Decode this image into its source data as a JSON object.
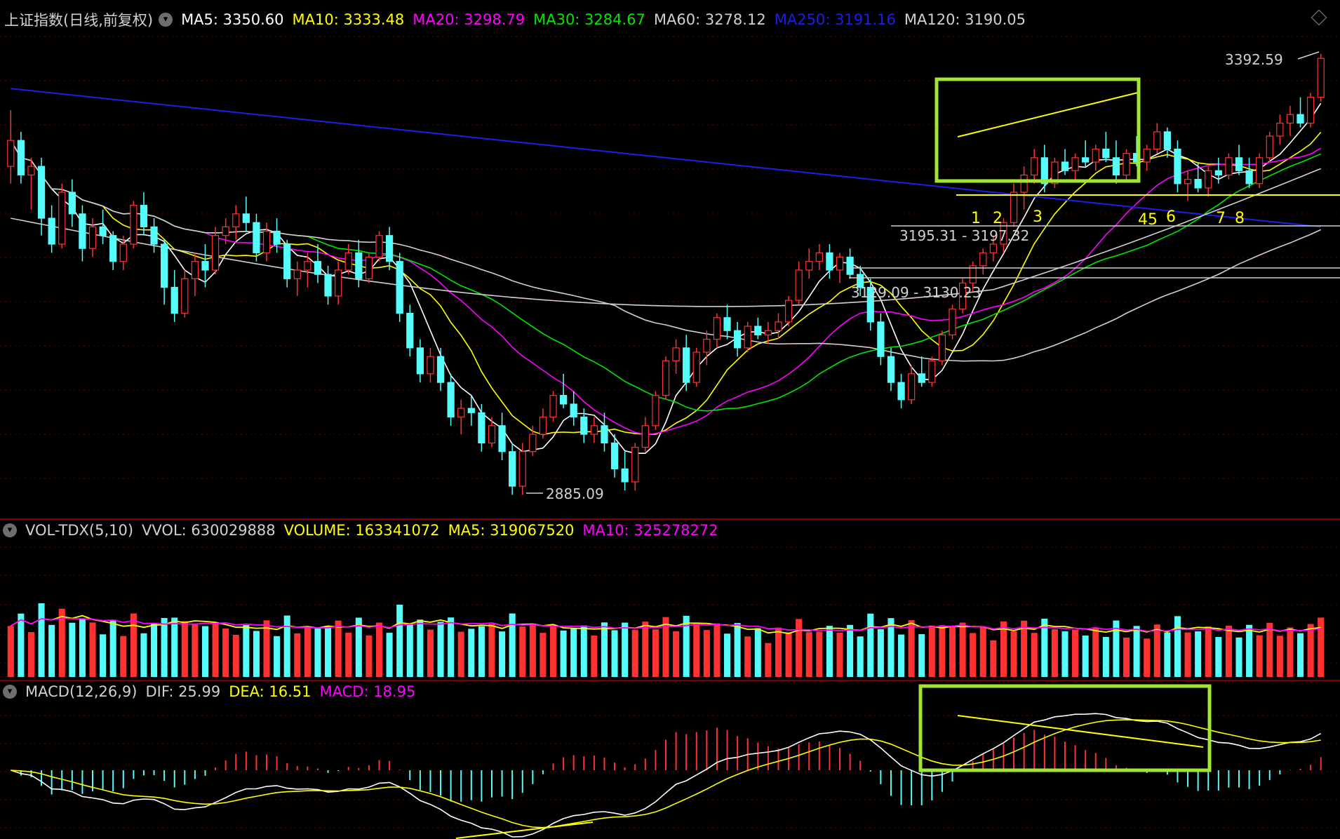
{
  "main_header": {
    "title": "上证指数(日线,前复权)",
    "ma5": "MA5: 3350.60",
    "ma10": "MA10: 3333.48",
    "ma20": "MA20: 3298.79",
    "ma30": "MA30: 3284.67",
    "ma60": "MA60: 3278.12",
    "ma250": "MA250: 3191.16",
    "ma120": "MA120: 3190.05"
  },
  "vol_header": {
    "title": "VOL-TDX(5,10)",
    "vvol": "VVOL: 630029888",
    "volume": "VOLUME: 163341072",
    "ma5": "MA5: 319067520",
    "ma10": "MA10: 325278272"
  },
  "macd_header": {
    "title": "MACD(12,26,9)",
    "dif": "DIF: 25.99",
    "dea": "DEA: 16.51",
    "macd": "MACD: 18.95"
  },
  "annotations": {
    "high": "3392.59",
    "low": "2885.09",
    "range1": "3195.31 - 3197.32",
    "range2": "3129.09 - 3130.23",
    "num1": "1",
    "num2": "2",
    "num3": "3",
    "num45": "45",
    "num6": "6",
    "num7": "7",
    "num8": "8"
  },
  "colors": {
    "up": "#ff3232",
    "down": "#54fcfc",
    "ma5": "#ffffff",
    "ma10": "#ffff00",
    "ma20": "#ff00ff",
    "ma30": "#00e600",
    "ma60": "#d0d0d0",
    "ma250": "#1e1ee6",
    "ma120": "#d0d0d0",
    "highlight": "#a0e632",
    "grid": "#6e0000"
  },
  "chart_data": {
    "type": "candlestick",
    "symbol": "上证指数",
    "period": "daily",
    "y_range": [
      2860,
      3420
    ],
    "candles_ohlc": [
      [
        3260,
        3325,
        3240,
        3290
      ],
      [
        3290,
        3300,
        3240,
        3250
      ],
      [
        3250,
        3270,
        3210,
        3260
      ],
      [
        3260,
        3270,
        3180,
        3200
      ],
      [
        3200,
        3215,
        3160,
        3170
      ],
      [
        3170,
        3240,
        3165,
        3230
      ],
      [
        3230,
        3245,
        3190,
        3205
      ],
      [
        3205,
        3215,
        3150,
        3165
      ],
      [
        3165,
        3200,
        3155,
        3190
      ],
      [
        3190,
        3210,
        3170,
        3180
      ],
      [
        3180,
        3185,
        3140,
        3150
      ],
      [
        3150,
        3180,
        3140,
        3170
      ],
      [
        3170,
        3220,
        3165,
        3215
      ],
      [
        3215,
        3230,
        3180,
        3190
      ],
      [
        3190,
        3200,
        3160,
        3170
      ],
      [
        3170,
        3175,
        3100,
        3120
      ],
      [
        3120,
        3140,
        3080,
        3090
      ],
      [
        3090,
        3140,
        3085,
        3130
      ],
      [
        3130,
        3160,
        3110,
        3150
      ],
      [
        3150,
        3170,
        3120,
        3140
      ],
      [
        3140,
        3190,
        3135,
        3180
      ],
      [
        3180,
        3200,
        3170,
        3190
      ],
      [
        3190,
        3215,
        3175,
        3205
      ],
      [
        3205,
        3225,
        3185,
        3195
      ],
      [
        3195,
        3205,
        3150,
        3160
      ],
      [
        3160,
        3195,
        3150,
        3185
      ],
      [
        3185,
        3200,
        3160,
        3170
      ],
      [
        3170,
        3175,
        3120,
        3130
      ],
      [
        3130,
        3150,
        3110,
        3140
      ],
      [
        3140,
        3160,
        3120,
        3150
      ],
      [
        3150,
        3170,
        3125,
        3135
      ],
      [
        3135,
        3145,
        3100,
        3110
      ],
      [
        3110,
        3150,
        3100,
        3140
      ],
      [
        3140,
        3170,
        3135,
        3160
      ],
      [
        3160,
        3175,
        3120,
        3130
      ],
      [
        3130,
        3160,
        3125,
        3155
      ],
      [
        3155,
        3185,
        3150,
        3180
      ],
      [
        3180,
        3190,
        3140,
        3150
      ],
      [
        3150,
        3160,
        3080,
        3090
      ],
      [
        3090,
        3100,
        3040,
        3050
      ],
      [
        3050,
        3060,
        3010,
        3020
      ],
      [
        3020,
        3050,
        3010,
        3040
      ],
      [
        3040,
        3050,
        3000,
        3010
      ],
      [
        3010,
        3020,
        2960,
        2970
      ],
      [
        2970,
        2990,
        2950,
        2980
      ],
      [
        2980,
        2995,
        2960,
        2975
      ],
      [
        2975,
        2985,
        2930,
        2940
      ],
      [
        2940,
        2970,
        2935,
        2960
      ],
      [
        2960,
        2975,
        2920,
        2930
      ],
      [
        2930,
        2940,
        2880,
        2890
      ],
      [
        2890,
        2940,
        2880,
        2930
      ],
      [
        2930,
        2960,
        2925,
        2950
      ],
      [
        2950,
        2980,
        2945,
        2970
      ],
      [
        2970,
        3000,
        2965,
        2995
      ],
      [
        2995,
        3020,
        2980,
        2985
      ],
      [
        2985,
        3000,
        2960,
        2970
      ],
      [
        2970,
        2980,
        2940,
        2950
      ],
      [
        2950,
        2970,
        2940,
        2960
      ],
      [
        2960,
        2975,
        2930,
        2940
      ],
      [
        2940,
        2950,
        2900,
        2910
      ],
      [
        2910,
        2930,
        2885,
        2895
      ],
      [
        2895,
        2940,
        2885,
        2935
      ],
      [
        2935,
        2970,
        2930,
        2960
      ],
      [
        2960,
        3000,
        2955,
        2995
      ],
      [
        2995,
        3040,
        2990,
        3035
      ],
      [
        3035,
        3060,
        3020,
        3050
      ],
      [
        3050,
        3065,
        3000,
        3010
      ],
      [
        3010,
        3050,
        3005,
        3045
      ],
      [
        3045,
        3070,
        3030,
        3060
      ],
      [
        3060,
        3090,
        3050,
        3085
      ],
      [
        3085,
        3100,
        3060,
        3070
      ],
      [
        3070,
        3080,
        3040,
        3050
      ],
      [
        3050,
        3080,
        3045,
        3075
      ],
      [
        3075,
        3085,
        3060,
        3065
      ],
      [
        3065,
        3080,
        3055,
        3070
      ],
      [
        3070,
        3090,
        3060,
        3080
      ],
      [
        3080,
        3110,
        3075,
        3105
      ],
      [
        3105,
        3150,
        3100,
        3140
      ],
      [
        3140,
        3165,
        3130,
        3150
      ],
      [
        3150,
        3170,
        3140,
        3160
      ],
      [
        3160,
        3170,
        3130,
        3140
      ],
      [
        3140,
        3160,
        3125,
        3155
      ],
      [
        3155,
        3165,
        3130,
        3135
      ],
      [
        3135,
        3145,
        3110,
        3120
      ],
      [
        3120,
        3130,
        3070,
        3080
      ],
      [
        3080,
        3090,
        3030,
        3040
      ],
      [
        3040,
        3050,
        3000,
        3010
      ],
      [
        3010,
        3020,
        2980,
        2990
      ],
      [
        2990,
        3030,
        2985,
        3020
      ],
      [
        3020,
        3040,
        3005,
        3010
      ],
      [
        3010,
        3040,
        3005,
        3035
      ],
      [
        3035,
        3070,
        3030,
        3065
      ],
      [
        3065,
        3100,
        3060,
        3095
      ],
      [
        3095,
        3130,
        3090,
        3125
      ],
      [
        3125,
        3150,
        3115,
        3145
      ],
      [
        3145,
        3165,
        3135,
        3160
      ],
      [
        3160,
        3180,
        3150,
        3170
      ],
      [
        3170,
        3200,
        3160,
        3195
      ],
      [
        3195,
        3240,
        3190,
        3230
      ],
      [
        3230,
        3260,
        3210,
        3250
      ],
      [
        3250,
        3280,
        3240,
        3270
      ],
      [
        3270,
        3285,
        3230,
        3240
      ],
      [
        3240,
        3270,
        3235,
        3265
      ],
      [
        3265,
        3280,
        3250,
        3255
      ],
      [
        3255,
        3275,
        3245,
        3270
      ],
      [
        3270,
        3290,
        3260,
        3265
      ],
      [
        3265,
        3285,
        3255,
        3280
      ],
      [
        3280,
        3300,
        3265,
        3270
      ],
      [
        3270,
        3290,
        3240,
        3250
      ],
      [
        3250,
        3280,
        3245,
        3275
      ],
      [
        3275,
        3295,
        3260,
        3265
      ],
      [
        3265,
        3285,
        3255,
        3280
      ],
      [
        3280,
        3310,
        3275,
        3300
      ],
      [
        3300,
        3305,
        3270,
        3280
      ],
      [
        3280,
        3290,
        3230,
        3240
      ],
      [
        3240,
        3255,
        3220,
        3245
      ],
      [
        3245,
        3265,
        3230,
        3235
      ],
      [
        3235,
        3260,
        3225,
        3255
      ],
      [
        3255,
        3270,
        3240,
        3250
      ],
      [
        3250,
        3275,
        3245,
        3270
      ],
      [
        3270,
        3285,
        3250,
        3255
      ],
      [
        3255,
        3270,
        3235,
        3240
      ],
      [
        3240,
        3275,
        3235,
        3270
      ],
      [
        3270,
        3300,
        3265,
        3295
      ],
      [
        3295,
        3320,
        3285,
        3310
      ],
      [
        3310,
        3330,
        3295,
        3320
      ],
      [
        3320,
        3340,
        3305,
        3310
      ],
      [
        3310,
        3345,
        3305,
        3340
      ],
      [
        3340,
        3390,
        3335,
        3385
      ]
    ],
    "moving_averages": [
      "MA5",
      "MA10",
      "MA20",
      "MA30",
      "MA60",
      "MA250",
      "MA120"
    ],
    "volume_series": [
      "VOLUME",
      "MA5",
      "MA10"
    ],
    "macd_series": [
      "DIF",
      "DEA",
      "MACD"
    ]
  }
}
